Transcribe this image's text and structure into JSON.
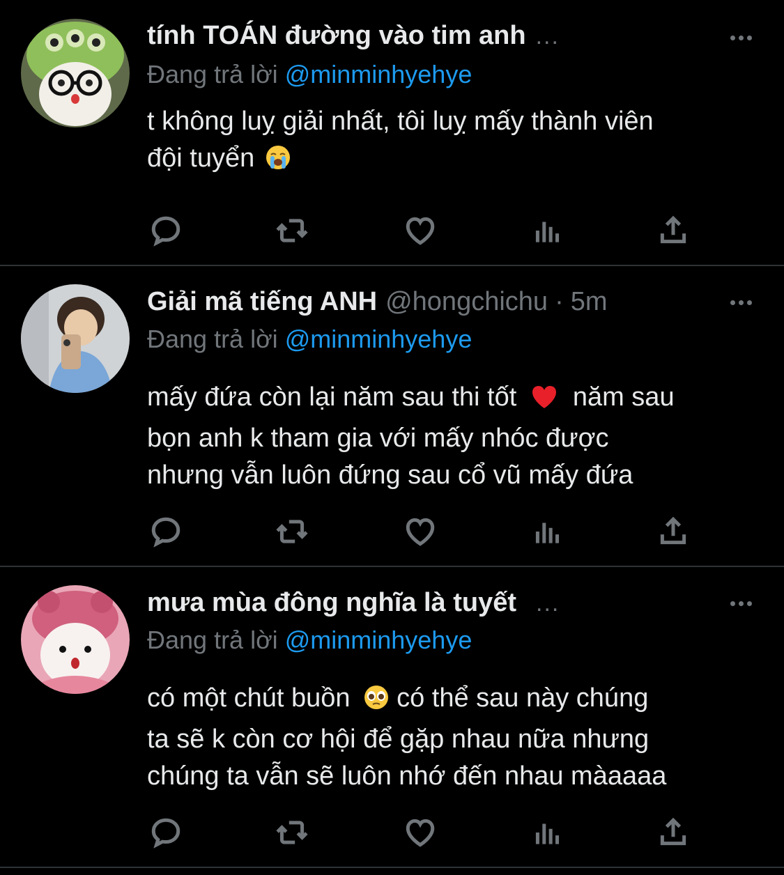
{
  "tweets": [
    {
      "name": "tính TOÁN đường vào tim anh",
      "name_ellipsis": "...",
      "handle": "",
      "time": "",
      "replying_prefix": "Đang trả lời",
      "replying_to": "@minminhyehye",
      "text_lines": [
        "t không luỵ giải nhất, tôi luỵ mấy thành viên",
        "đội tuyển"
      ],
      "emoji": "loudly-crying-face",
      "avatar": "green-plush-toy-with-glasses"
    },
    {
      "name": "Giải mã tiếng ANH",
      "handle": "@hongchichu",
      "dot": "·",
      "time": "5m",
      "replying_prefix": "Đang trả lời",
      "replying_to": "@minminhyehye",
      "text_lines": [
        "mấy đứa còn lại năm sau thi tốt",
        "năm sau",
        "bọn anh k tham gia với mấy nhóc được",
        "nhưng vẫn luôn đứng sau cổ vũ mấy đứa"
      ],
      "emoji": "red-heart",
      "avatar": "person-mirror-selfie"
    },
    {
      "name": "mưa mùa đông nghĩa là tuyết",
      "name_ellipsis": "...",
      "handle": "",
      "time": "",
      "replying_prefix": "Đang trả lời",
      "replying_to": "@minminhyehye",
      "text_lines": [
        "có một chút buồn",
        "có thể sau này chúng",
        "ta sẽ k còn cơ hội để gặp nhau nữa nhưng",
        "chúng ta vẫn sẽ luôn nhớ đến nhau màaaaa"
      ],
      "emoji": "pleading-face",
      "avatar": "pink-plush-toy"
    }
  ],
  "actions": [
    "reply-icon",
    "retweet-icon",
    "like-icon",
    "views-icon",
    "share-icon"
  ],
  "colors": {
    "background": "#000000",
    "text": "#e7e9ea",
    "muted": "#71767b",
    "link": "#1d9bf0",
    "divider": "#2f3336"
  }
}
